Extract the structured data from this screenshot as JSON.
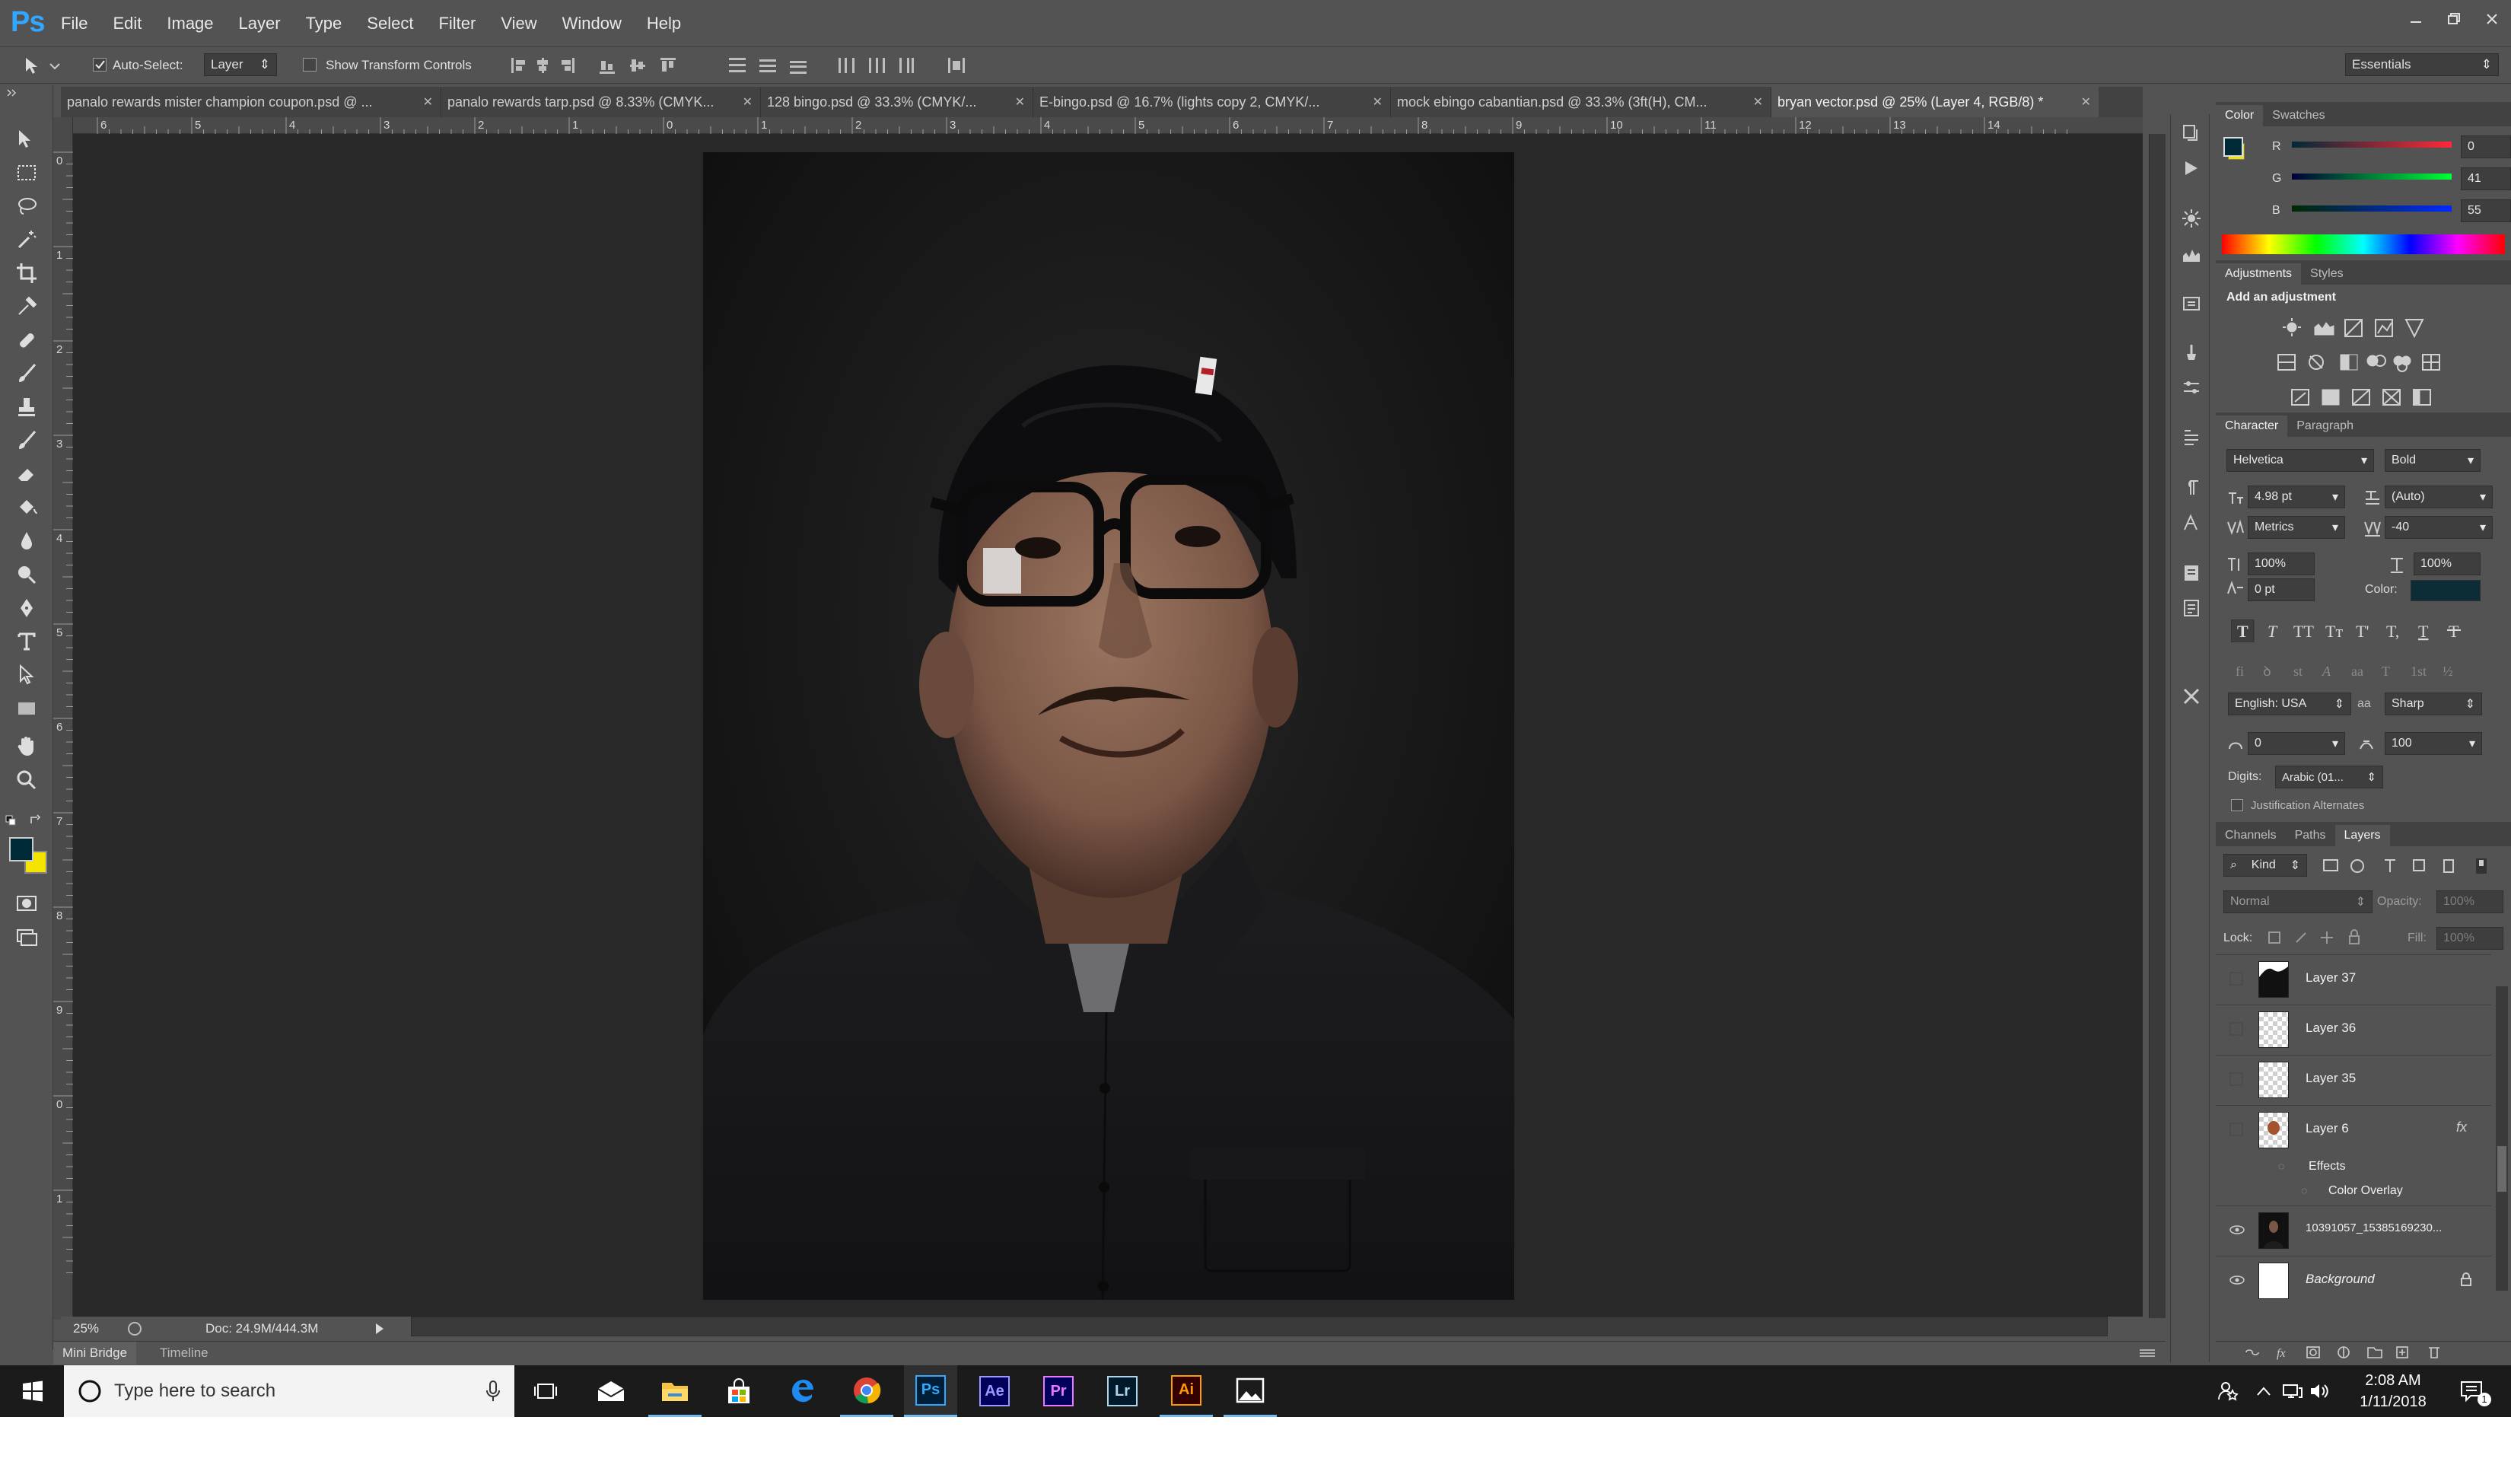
{
  "app": {
    "logo": "Ps"
  },
  "menu": [
    "File",
    "Edit",
    "Image",
    "Layer",
    "Type",
    "Select",
    "Filter",
    "View",
    "Window",
    "Help"
  ],
  "options": {
    "auto_select_label": "Auto-Select:",
    "auto_select_checked": true,
    "auto_select_value": "Layer",
    "transform_label": "Show Transform Controls",
    "workspace": "Essentials"
  },
  "tabs": [
    {
      "label": "panalo rewards mister champion coupon.psd @ ..."
    },
    {
      "label": "panalo rewards tarp.psd @ 8.33% (CMYK..."
    },
    {
      "label": "128 bingo.psd @ 33.3% (CMYK/..."
    },
    {
      "label": "E-bingo.psd @ 16.7% (lights copy 2, CMYK/..."
    },
    {
      "label": "mock ebingo cabantian.psd @ 33.3% (3ft(H), CM..."
    },
    {
      "label": "bryan vector.psd @ 25% (Layer 4, RGB/8) *"
    }
  ],
  "ruler": {
    "top": [
      "6",
      "5",
      "4",
      "3",
      "2",
      "1",
      "0",
      "1",
      "2",
      "3",
      "4",
      "5",
      "6",
      "7",
      "8",
      "9",
      "10",
      "11",
      "12",
      "13",
      "14"
    ],
    "left": [
      "0",
      "1",
      "2",
      "3",
      "4",
      "5",
      "6",
      "7",
      "8",
      "9",
      "0",
      "1"
    ]
  },
  "status": {
    "zoom": "25%",
    "doc": "Doc: 24.9M/444.3M"
  },
  "bottom_tabs": [
    "Mini Bridge",
    "Timeline"
  ],
  "color_panel": {
    "tabs": [
      "Color",
      "Swatches"
    ],
    "r_label": "R",
    "g_label": "G",
    "b_label": "B",
    "r": "0",
    "g": "41",
    "b": "55",
    "foreground": "#002937",
    "background": "#f5e400"
  },
  "adjustments": {
    "tabs": [
      "Adjustments",
      "Styles"
    ],
    "title": "Add an adjustment"
  },
  "character": {
    "tabs": [
      "Character",
      "Paragraph"
    ],
    "font": "Helvetica",
    "style": "Bold",
    "size": "4.98 pt",
    "leading": "(Auto)",
    "kerning": "Metrics",
    "tracking": "-40",
    "vscale": "100%",
    "hscale": "100%",
    "baseline": "0 pt",
    "color_label": "Color:",
    "color": "#0c2c36",
    "language": "English: USA",
    "antialias_icon": "aa",
    "antialias": "Sharp",
    "field_a": "0",
    "field_b": "100",
    "digits_label": "Digits:",
    "digits": "Arabic (01...",
    "justification": "Justification Alternates"
  },
  "layers_panel": {
    "tabs": [
      "Channels",
      "Paths",
      "Layers"
    ],
    "filter": "Kind",
    "blend": "Normal",
    "opacity_label": "Opacity:",
    "opacity": "100%",
    "lock_label": "Lock:",
    "fill_label": "Fill:",
    "fill": "100%",
    "layers": [
      {
        "name": "Layer 37",
        "visible": false
      },
      {
        "name": "Layer 36",
        "visible": false
      },
      {
        "name": "Layer 35",
        "visible": false
      },
      {
        "name": "Layer 6",
        "visible": false,
        "fx": "fx"
      },
      {
        "name": "Effects"
      },
      {
        "name": "Color Overlay"
      },
      {
        "name": "10391057_15385169230...",
        "visible": true
      },
      {
        "name": "Background",
        "visible": true
      }
    ]
  },
  "taskbar": {
    "search_placeholder": "Type here to search",
    "apps": [
      "Ps",
      "Ae",
      "Pr",
      "Lr",
      "Ai"
    ],
    "time": "2:08 AM",
    "date": "1/11/2018",
    "notification_count": "1"
  }
}
